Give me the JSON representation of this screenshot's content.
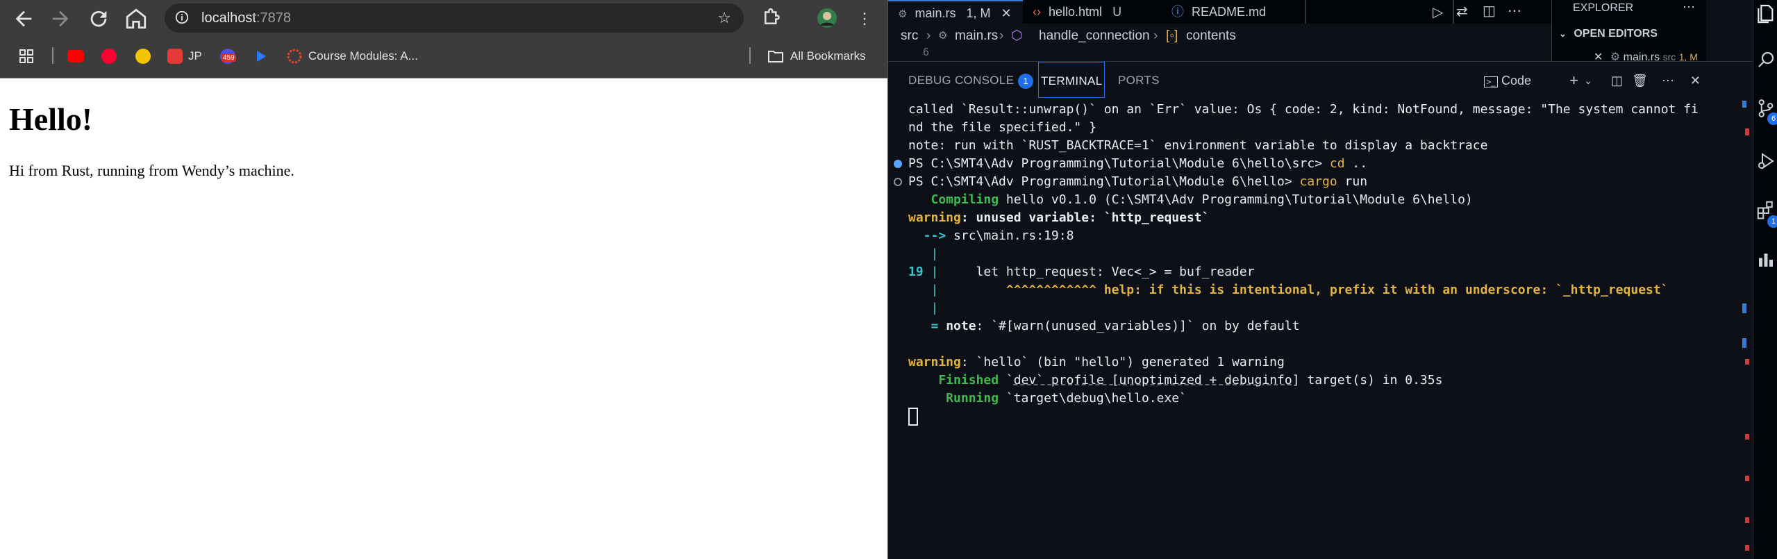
{
  "browser": {
    "url_host": "localhost",
    "url_port": ":7878",
    "bookmarks": {
      "jp_label": "JP",
      "badge_count": "459",
      "course_modules_label": "Course Modules: A...",
      "all_bookmarks_label": "All Bookmarks"
    },
    "page": {
      "heading": "Hello!",
      "paragraph": "Hi from Rust, running from Wendy’s machine."
    }
  },
  "vscode": {
    "tabs": [
      {
        "label": "main.rs",
        "status": "1, M"
      },
      {
        "label": "hello.html",
        "status": "U"
      },
      {
        "label": "README.md",
        "status": ""
      }
    ],
    "breadcrumb": [
      "src",
      "main.rs",
      "handle_connection",
      "contents"
    ],
    "editor_line_number": "6",
    "explorer": {
      "title": "EXPLORER",
      "open_editors": "OPEN EDITORS",
      "open_item": "main.rs",
      "open_item_path": "src",
      "open_item_status": "1, M"
    },
    "panel": {
      "tabs": {
        "debug_console": "DEBUG CONSOLE",
        "debug_badge": "1",
        "terminal": "TERMINAL",
        "ports": "PORTS"
      },
      "shell_label": "Code"
    },
    "terminal": {
      "l1": "called `Result::unwrap()` on an `Err` value: Os { code: 2, kind: NotFound, message: \"The system cannot fi",
      "l2": "nd the file specified.\" }",
      "l3": "note: run with `RUST_BACKTRACE=1` environment variable to display a backtrace",
      "l4_prompt": "PS C:\\SMT4\\Adv Programming\\Tutorial\\Module 6\\hello\\src> ",
      "l4_cmd": "cd",
      "l4_arg": " ..",
      "l5_prompt": "PS C:\\SMT4\\Adv Programming\\Tutorial\\Module 6\\hello> ",
      "l5_cmd": "cargo",
      "l5_arg": " run",
      "l6_kw": "   Compiling",
      "l6_rest": " hello v0.1.0 (C:\\SMT4\\Adv Programming\\Tutorial\\Module 6\\hello)",
      "l7_kw": "warning",
      "l7_rest": ": unused variable: `http_request`",
      "l8_arrow": "  -->",
      "l8_rest": " src\\main.rs:19:8",
      "l9": "   |",
      "l10_num": "19",
      "l10_bar": " |",
      "l10_code": "     let http_request: Vec<_> = buf_reader",
      "l11_bar": "   |",
      "l11_carets": "         ^^^^^^^^^^^^ help: if this is intentional, prefix it with an underscore: `_http_request`",
      "l12": "   |",
      "l13_eq": "   =",
      "l13_note": " note",
      "l13_rest": ": `#[warn(unused_variables)]` on by default",
      "l14_kw": "warning",
      "l14_rest": ": `hello` (bin \"hello\") generated 1 warning",
      "l15_kw": "    Finished",
      "l15_rest_a": " `",
      "l15_dev": "dev` profile [unoptimized + debuginfo",
      "l15_rest_b": "] target(s) in 0.35s",
      "l16_kw": "     Running",
      "l16_rest": " `target\\debug\\hello.exe`"
    },
    "activity_badges": {
      "source_control": "6",
      "extensions": "1"
    }
  },
  "colors": {
    "accent_blue": "#1f6feb",
    "terminal_yellow": "#e3b341",
    "terminal_green": "#3fb950",
    "terminal_cyan": "#39c5cf"
  }
}
